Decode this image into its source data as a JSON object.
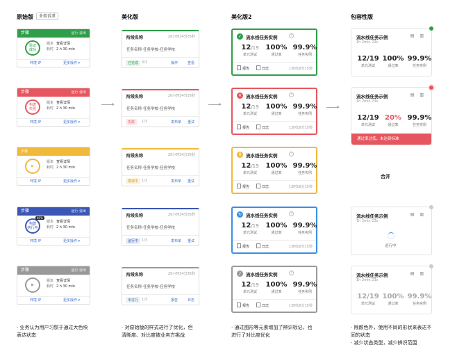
{
  "headers": {
    "col1": "原始版",
    "col1_tag": "业务诉求",
    "col2": "美化版",
    "col3": "美化版2",
    "col4": "包容性版"
  },
  "original": {
    "actions": "运行 退出",
    "meta_labels": [
      "版本",
      "耗时"
    ],
    "meta_values": [
      "查看详情",
      "2 h 30 min"
    ],
    "foot_left": "环境 IP",
    "foot_right": "更多操作 ▾",
    "cards": [
      {
        "title": "步骤",
        "ring": [
          "验证",
          "成功"
        ],
        "color": "#2e9e49"
      },
      {
        "title": "步骤",
        "ring": [
          "构建",
          "失败"
        ],
        "color": "#e5565f"
      },
      {
        "title": "步骤",
        "ring": [
          "▶",
          ""
        ],
        "color": "#f0b93a"
      },
      {
        "title": "步骤",
        "ring": [
          "构建",
          "执行中"
        ],
        "color": "#3a57b5",
        "badge": "80%"
      },
      {
        "title": "步骤",
        "ring": [
          "▶",
          ""
        ],
        "color": "#999999"
      }
    ]
  },
  "optimized": {
    "title": "阶段名称",
    "time": "20小时34分35秒",
    "desc": "任务名称-任务学校-任务学校",
    "cards": [
      {
        "status": "已完成",
        "count": "3/3",
        "a1": "操作",
        "a2": "查看",
        "color": "#2e9e49",
        "bg": "#e7f6ec",
        "fg": "#2e9e49"
      },
      {
        "status": "失败",
        "count": "1/3",
        "a1": "发布单",
        "a2": "重试",
        "color": "#e5565f",
        "bg": "#fde9ea",
        "fg": "#e5565f"
      },
      {
        "status": "等待中",
        "count": "1/3",
        "a1": "发布单",
        "a2": "重试",
        "color": "#f0b93a",
        "bg": "#fdf3dd",
        "fg": "#d49a1a"
      },
      {
        "status": "运行中",
        "count": "1/3",
        "a1": "发布单",
        "a2": "重试",
        "color": "#3a57b5",
        "bg": "#e5ecfb",
        "fg": "#3a57b5"
      },
      {
        "status": "未进行",
        "count": "1/3",
        "a1": "报告",
        "a2": "日志",
        "color": "#999999",
        "bg": "#eef3f8",
        "fg": "#5577aa"
      }
    ]
  },
  "v2": {
    "title": "流水线任务实例",
    "stats": [
      {
        "v": "12",
        "s": "/19",
        "l": "单元测试"
      },
      {
        "v": "100%",
        "s": "",
        "l": "通过率"
      },
      {
        "v": "99.9%",
        "s": "",
        "l": "任务实例"
      }
    ],
    "links": [
      "报告",
      "日志"
    ],
    "time": "13时16分15秒",
    "cards": [
      {
        "color": "#2e9e49",
        "icon": "✓"
      },
      {
        "color": "#e5565f",
        "icon": "✕"
      },
      {
        "color": "#f0b93a",
        "icon": "II"
      },
      {
        "color": "#3a8ee6",
        "icon": "↻"
      },
      {
        "color": "#999999",
        "icon": "♪"
      }
    ]
  },
  "inclusive": {
    "title": "流水线任务示例",
    "sub": "1h 2min 23s",
    "c1": {
      "stats": [
        {
          "v": "12/19",
          "l": "单元测试"
        },
        {
          "v": "100%",
          "l": "通过率"
        },
        {
          "v": "99.9%",
          "l": "任务实例"
        }
      ],
      "dot": "#2e9e49"
    },
    "c2": {
      "stats": [
        {
          "v": "12/19",
          "l": "单元测试"
        },
        {
          "v": "20%",
          "l": "通过率"
        },
        {
          "v": "99.9%",
          "l": "任务实例"
        }
      ],
      "dot": "#e5565f",
      "err": "通过率过低，未达到标准",
      "err_color": "#e5565f"
    },
    "merge": "合并",
    "c3": {
      "running": "运行中",
      "dot": "#cccccc"
    },
    "c4": {
      "stats": [
        {
          "v": "12/19",
          "l": "单元测试"
        },
        {
          "v": "100%",
          "l": "通过率"
        },
        {
          "v": "99.9%",
          "l": "任务实例"
        }
      ],
      "dot": "#cccccc"
    }
  },
  "notes": {
    "col1": [
      "· 业务认为用户习惯于通过大色块",
      "  表达状态"
    ],
    "col2": [
      "· 对原始版的样式进行了优化，但",
      "  清晰度、对比度被业务方挑战"
    ],
    "col3": [
      "· 通过图形等元素增加了辨识标记，也",
      "  进行了对比度优化"
    ],
    "col4": [
      "· 除颜色外，使用不同的形状来表达不",
      "  同的状态",
      "· 减少状态类型，减少辨识范围"
    ]
  }
}
